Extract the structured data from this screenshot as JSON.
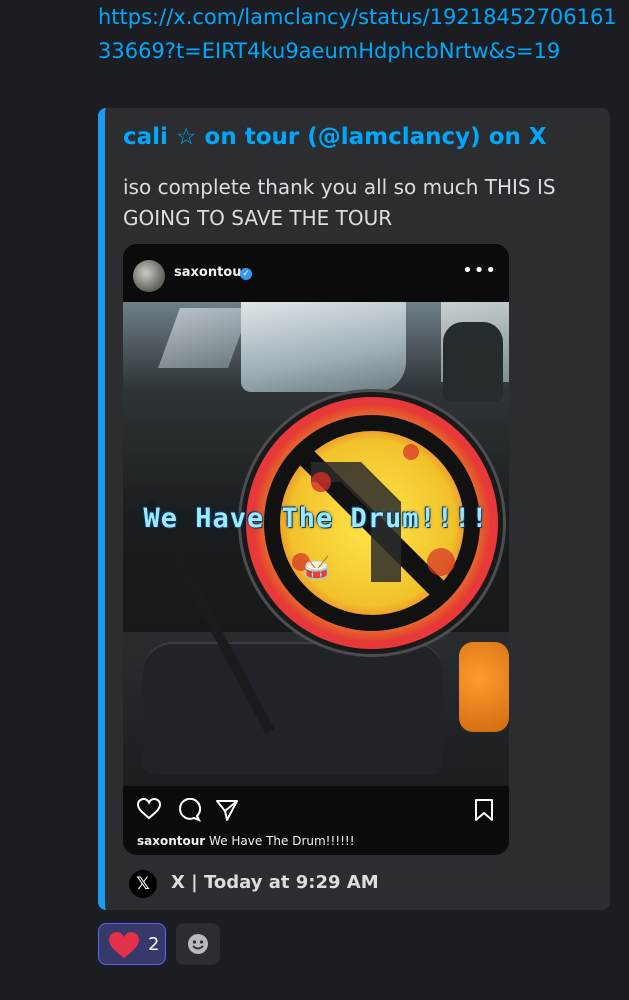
{
  "message": {
    "link_text": "https://x.com/lamclancy/status/1921845270616133669?t=EIRT4ku9aeumHdphcbNrtw&s=19"
  },
  "embed": {
    "accent_color": "#1d9bf0",
    "author": "cali ☆ on tour (@lamclancy) on X",
    "description": "iso complete thank you all so much THIS IS GOING TO SAVE THE TOUR",
    "post": {
      "username": "saxontour",
      "verified": true,
      "more_label": "•••",
      "overlay_text": "We Have The Drum!!!!",
      "overlay_emoji": "🥁",
      "caption_user": "saxontour",
      "caption_text": "We Have The Drum!!!!!!",
      "actions": [
        "heart-icon",
        "comment-icon",
        "share-icon",
        "bookmark-icon"
      ]
    },
    "source": {
      "logo": "𝕏",
      "text": "X | Today at 9:29 AM"
    }
  },
  "reactions": [
    {
      "emoji": "heart",
      "count": "2",
      "active": true,
      "color": "#e5304a"
    }
  ]
}
